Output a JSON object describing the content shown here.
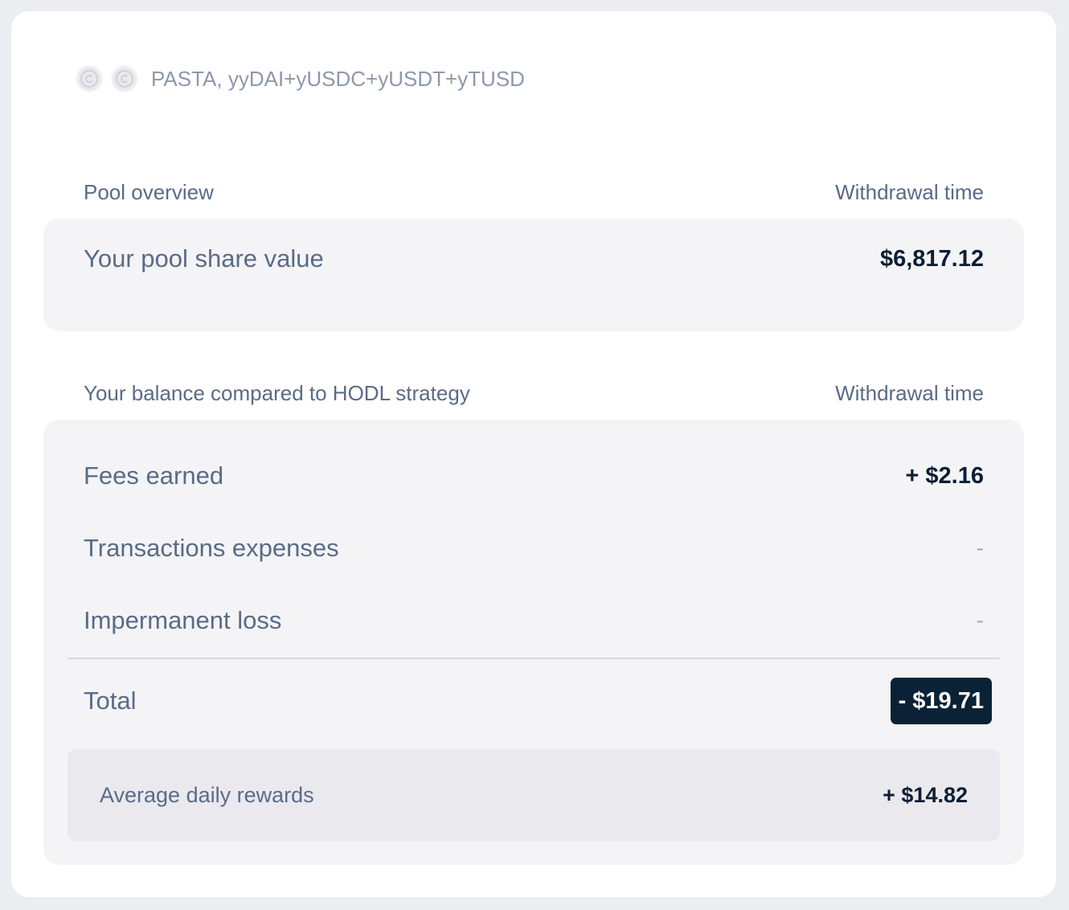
{
  "pool": {
    "icons": [
      "copyright-icon",
      "copyright-icon"
    ],
    "name": "PASTA, yyDAI+yUSDC+yUSDT+yTUSD"
  },
  "overview": {
    "heading": "Pool overview",
    "time_label": "Withdrawal time",
    "share_label": "Your pool share value",
    "share_value": "$6,817.12"
  },
  "hodl": {
    "heading": "Your balance compared to HODL strategy",
    "time_label": "Withdrawal time",
    "fees_label": "Fees earned",
    "fees_value": "+ $2.16",
    "tx_label": "Transactions expenses",
    "tx_value": "-",
    "il_label": "Impermanent loss",
    "il_value": "-",
    "total_label": "Total",
    "total_value": "- $19.71",
    "rewards_label": "Average daily rewards",
    "rewards_value": "+ $14.82"
  },
  "colors": {
    "accent_dark": "#0b2236",
    "label_text": "#5a6b86",
    "panel_bg": "#f4f4f7"
  }
}
